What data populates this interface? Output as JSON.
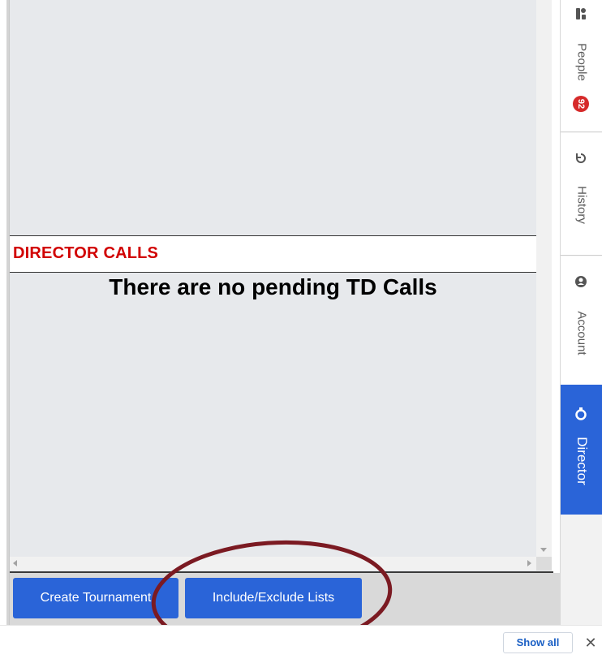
{
  "director_calls": {
    "header": "DIRECTOR CALLS",
    "empty_message": "There are no pending TD Calls"
  },
  "footer": {
    "create_tournament_label": "Create Tournament",
    "include_exclude_label": "Include/Exclude Lists"
  },
  "side_tabs": {
    "people": {
      "label": "People",
      "badge": "92",
      "icon": "people-icon"
    },
    "history": {
      "label": "History",
      "icon": "history-icon"
    },
    "account": {
      "label": "Account",
      "icon": "account-icon"
    },
    "director": {
      "label": "Director",
      "icon": "director-icon",
      "active": true
    }
  },
  "download_bar": {
    "show_all_label": "Show all",
    "close_label": "✕"
  },
  "colors": {
    "accent": "#2a64d8",
    "header_red": "#d10000",
    "annotation": "#7b1a22",
    "badge": "#d62a2a"
  }
}
